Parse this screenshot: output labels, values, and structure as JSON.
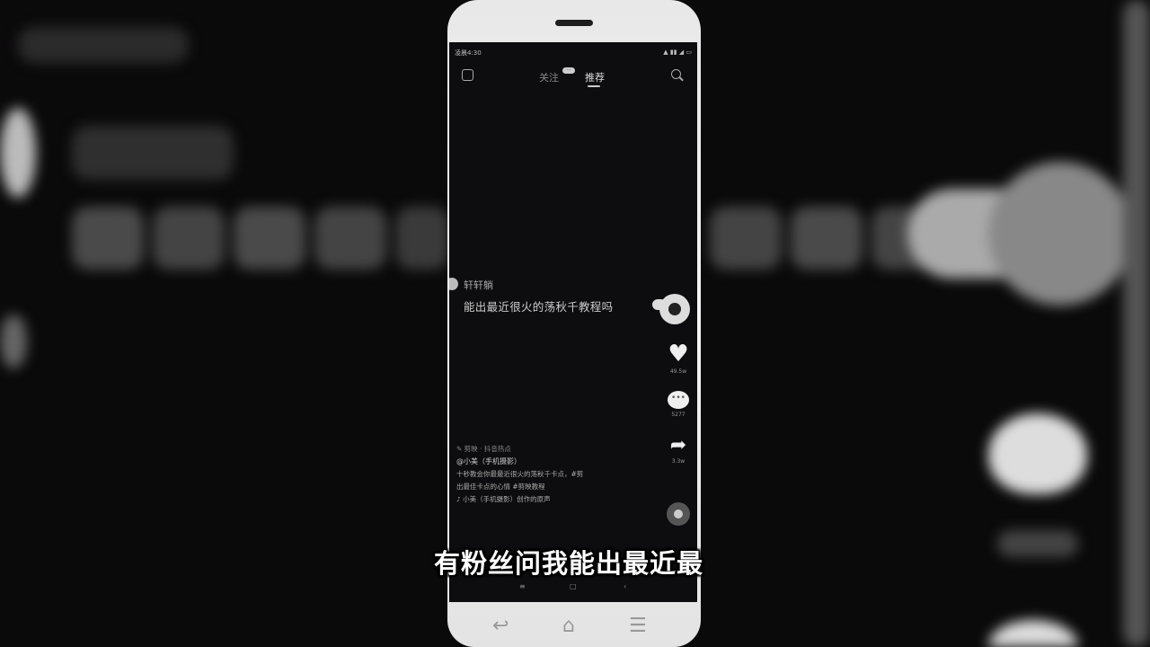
{
  "status_bar": {
    "time": "凌晨4:30",
    "indicators": "▲ ▮▮ ◢ ▭"
  },
  "top_nav": {
    "tabs": [
      {
        "label": "关注",
        "active": false
      },
      {
        "label": "推荐",
        "active": true
      }
    ],
    "follow_badge": "···",
    "left_icon": "live-icon",
    "right_icon": "search-icon"
  },
  "comment": {
    "username": "轩轩躺",
    "text": "能出最近很火的荡秋千教程吗"
  },
  "actions": {
    "likes": "49.5w",
    "comments": "5277",
    "shares": "3.3w"
  },
  "caption": {
    "meta": "✎ 剪映 · 抖音热点",
    "author": "@小美（手机摄影）",
    "line1": "十秒教会你最最近很火的荡秋千卡点，#剪",
    "line2": "出最佳卡点的心情 #剪映教程",
    "music": "♪ 小美（手机摄影）创作的原声"
  },
  "soft_keys": [
    "≡",
    "□",
    "‹"
  ],
  "hardware_keys": [
    "↩",
    "⌂",
    "☰"
  ],
  "subtitle": "有粉丝问我能出最近最"
}
